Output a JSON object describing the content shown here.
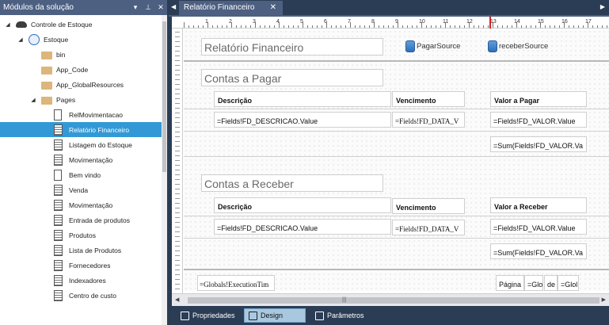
{
  "solution_panel": {
    "title": "Módulos da solução",
    "pin_icon": "pin-icon",
    "close_icon": "close-icon",
    "dropdown_icon": "chevron-down-icon",
    "tree": [
      {
        "label": "Controle de Estoque",
        "icon": "cloud-icon",
        "expand": "◢"
      },
      {
        "label": "Estoque",
        "icon": "web-project-icon",
        "expand": "◢"
      },
      {
        "label": "bin",
        "icon": "folder-icon",
        "expand": ""
      },
      {
        "label": "App_Code",
        "icon": "folder-icon",
        "expand": ""
      },
      {
        "label": "App_GlobalResources",
        "icon": "folder-icon",
        "expand": ""
      },
      {
        "label": "Pages",
        "icon": "folder-icon",
        "expand": "◢"
      },
      {
        "label": "RelMovimentacao",
        "icon": "page-icon",
        "expand": ""
      },
      {
        "label": "Relatório Financeiro",
        "icon": "report-icon",
        "expand": "",
        "selected": true
      },
      {
        "label": "Listagem do Estoque",
        "icon": "report-icon",
        "expand": ""
      },
      {
        "label": "Movimentação",
        "icon": "report-icon",
        "expand": ""
      },
      {
        "label": "Bem vindo",
        "icon": "page-icon",
        "expand": ""
      },
      {
        "label": "Venda",
        "icon": "report-icon",
        "expand": ""
      },
      {
        "label": "Movimentação",
        "icon": "report-icon",
        "expand": ""
      },
      {
        "label": "Entrada de produtos",
        "icon": "report-icon",
        "expand": ""
      },
      {
        "label": "Produtos",
        "icon": "report-icon",
        "expand": ""
      },
      {
        "label": "Lista de Produtos",
        "icon": "report-icon",
        "expand": ""
      },
      {
        "label": "Fornecedores",
        "icon": "report-icon",
        "expand": ""
      },
      {
        "label": "Indexadores",
        "icon": "report-icon",
        "expand": ""
      },
      {
        "label": "Centro de custo",
        "icon": "report-icon",
        "expand": ""
      }
    ]
  },
  "document_tab": {
    "label": "Relatório Financeiro",
    "close": "✕"
  },
  "ruler": {
    "numbers": [
      "1",
      "2",
      "3",
      "4",
      "5",
      "6",
      "7",
      "8",
      "9",
      "10",
      "11",
      "12",
      "13",
      "14",
      "15",
      "16",
      "17"
    ]
  },
  "report": {
    "title": "Relatório Financeiro",
    "datasources": [
      "PagarSource",
      "receberSource"
    ],
    "pagar": {
      "heading": "Contas a Pagar",
      "headers": [
        "Descrição",
        "Vencimento",
        "Valor a Pagar"
      ],
      "row": [
        "=Fields!FD_DESCRICAO.Value",
        "=Fields!FD_DATA_V",
        "=Fields!FD_VALOR.Value"
      ],
      "total": "=Sum(Fields!FD_VALOR.Va"
    },
    "receber": {
      "heading": "Contas a Receber",
      "headers": [
        "Descrição",
        "Vencimento",
        "Valor a Receber"
      ],
      "row": [
        "=Fields!FD_DESCRICAO.Value",
        "=Fields!FD_DATA_V",
        "=Fields!FD_VALOR.Value"
      ],
      "total": "=Sum(Fields!FD_VALOR.Va"
    },
    "footer": {
      "execution_time": "=Globals!ExecutionTim",
      "page_label": "Página",
      "page_num": "=Glol",
      "of_label": "de",
      "total_pages": "=Glol"
    }
  },
  "scrollbar": {
    "grip": "|||"
  },
  "bottom_tabs": [
    {
      "label": "Propriedades",
      "icon": "properties-icon",
      "active": false
    },
    {
      "label": "Design",
      "icon": "design-icon",
      "active": true
    },
    {
      "label": "Parâmetros",
      "icon": "parameters-icon",
      "active": false
    }
  ],
  "colors": {
    "chrome": "#2b3d55",
    "titlebar": "#4d6082",
    "selection": "#3399d6",
    "ruler_marker": "#e02020"
  }
}
